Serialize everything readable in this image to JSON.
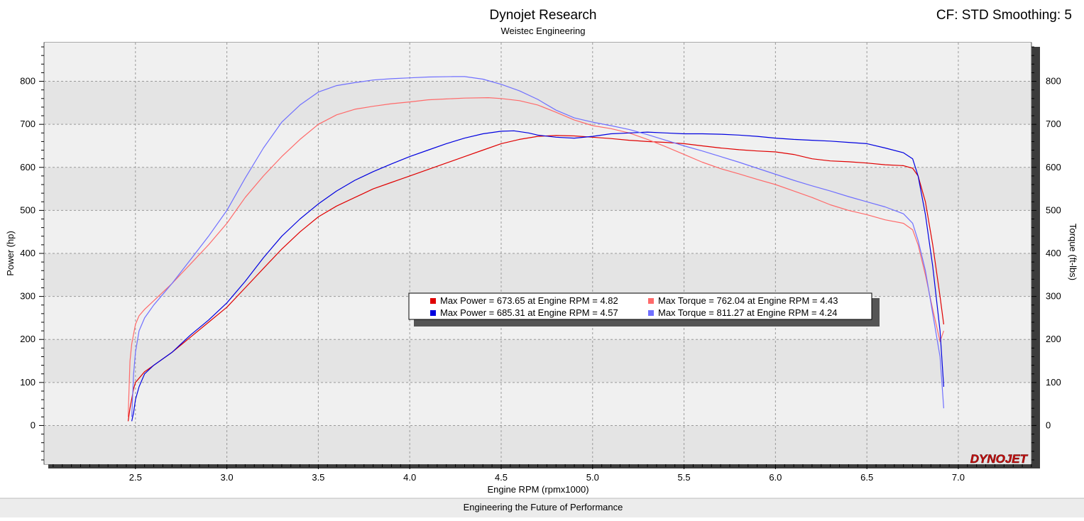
{
  "header": {
    "title": "Dynojet Research",
    "subtitle": "Weistec Engineering",
    "settings": "CF: STD Smoothing: 5"
  },
  "footer": {
    "tagline": "Engineering the Future of Performance"
  },
  "logo": {
    "text": "DYNOJET"
  },
  "colors": {
    "run1_power": "#e00000",
    "run1_torque": "#ff6a6a",
    "run2_power": "#0000e0",
    "run2_torque": "#7070ff",
    "band_dark": "#e4e4e4",
    "band_light": "#f0f0f0"
  },
  "legend": [
    {
      "label": "Max Power = 673.65 at Engine RPM = 4.82",
      "color": "#e00000"
    },
    {
      "label": "Max Torque = 762.04 at Engine RPM = 4.43",
      "color": "#ff6a6a"
    },
    {
      "label": "Max Power = 685.31 at Engine RPM = 4.57",
      "color": "#0000e0"
    },
    {
      "label": "Max Torque = 811.27 at Engine RPM = 4.24",
      "color": "#7070ff"
    }
  ],
  "chart_data": {
    "type": "line",
    "xlabel": "Engine RPM (rpmx1000)",
    "ylabel_left": "Power (hp)",
    "ylabel_right": "Torque (ft-lbs)",
    "xlim": [
      2.0,
      7.4
    ],
    "ylim": [
      -90,
      890
    ],
    "xticks": [
      "2.5",
      "3.0",
      "3.5",
      "4.0",
      "4.5",
      "5.0",
      "5.5",
      "6.0",
      "6.5",
      "7.0"
    ],
    "yticks": [
      "0",
      "100",
      "200",
      "300",
      "400",
      "500",
      "600",
      "700",
      "800"
    ],
    "grid": true,
    "legend_position": "center",
    "series": [
      {
        "color": "#e00000",
        "x": [
          2.46,
          2.47,
          2.49,
          2.5,
          2.55,
          2.6,
          2.7,
          2.8,
          2.9,
          3.0,
          3.1,
          3.2,
          3.3,
          3.4,
          3.5,
          3.6,
          3.7,
          3.8,
          3.9,
          4.0,
          4.1,
          4.2,
          4.3,
          4.4,
          4.5,
          4.6,
          4.7,
          4.8,
          4.9,
          5.0,
          5.1,
          5.2,
          5.3,
          5.4,
          5.5,
          5.6,
          5.7,
          5.8,
          5.9,
          6.0,
          6.1,
          6.2,
          6.3,
          6.4,
          6.5,
          6.6,
          6.7,
          6.75,
          6.78,
          6.82,
          6.86,
          6.9,
          6.92
        ],
        "values": [
          10,
          40,
          85,
          100,
          125,
          140,
          170,
          205,
          240,
          275,
          320,
          365,
          410,
          450,
          485,
          510,
          530,
          550,
          565,
          580,
          595,
          610,
          625,
          640,
          655,
          665,
          672,
          674,
          673,
          670,
          667,
          663,
          660,
          658,
          655,
          650,
          645,
          641,
          638,
          636,
          630,
          620,
          615,
          613,
          610,
          606,
          604,
          598,
          580,
          520,
          420,
          300,
          235
        ]
      },
      {
        "color": "#ff6a6a",
        "x": [
          2.46,
          2.47,
          2.48,
          2.5,
          2.52,
          2.55,
          2.6,
          2.7,
          2.8,
          2.9,
          3.0,
          3.1,
          3.2,
          3.3,
          3.4,
          3.5,
          3.6,
          3.7,
          3.8,
          3.9,
          4.0,
          4.1,
          4.2,
          4.3,
          4.43,
          4.5,
          4.6,
          4.7,
          4.8,
          4.9,
          5.0,
          5.1,
          5.2,
          5.3,
          5.4,
          5.5,
          5.6,
          5.7,
          5.8,
          5.9,
          6.0,
          6.1,
          6.2,
          6.3,
          6.4,
          6.5,
          6.6,
          6.7,
          6.75,
          6.78,
          6.82,
          6.86,
          6.9,
          6.92
        ],
        "values": [
          20,
          150,
          190,
          235,
          255,
          270,
          290,
          330,
          375,
          420,
          470,
          530,
          580,
          625,
          665,
          700,
          722,
          735,
          742,
          748,
          752,
          757,
          759,
          761,
          762,
          760,
          755,
          745,
          728,
          710,
          697,
          690,
          680,
          665,
          648,
          630,
          612,
          597,
          585,
          572,
          560,
          545,
          530,
          513,
          500,
          490,
          478,
          470,
          455,
          420,
          350,
          270,
          195,
          220
        ]
      },
      {
        "color": "#0000e0",
        "x": [
          2.48,
          2.49,
          2.5,
          2.52,
          2.55,
          2.6,
          2.7,
          2.8,
          2.9,
          3.0,
          3.1,
          3.2,
          3.3,
          3.4,
          3.5,
          3.6,
          3.7,
          3.8,
          3.9,
          4.0,
          4.1,
          4.2,
          4.3,
          4.4,
          4.5,
          4.57,
          4.65,
          4.7,
          4.8,
          4.9,
          5.0,
          5.1,
          5.2,
          5.3,
          5.4,
          5.5,
          5.6,
          5.7,
          5.8,
          5.9,
          6.0,
          6.1,
          6.2,
          6.3,
          6.4,
          6.5,
          6.6,
          6.7,
          6.75,
          6.78,
          6.82,
          6.86,
          6.9,
          6.92
        ],
        "values": [
          10,
          30,
          60,
          90,
          120,
          140,
          170,
          210,
          245,
          285,
          335,
          390,
          440,
          480,
          515,
          545,
          570,
          590,
          608,
          625,
          640,
          655,
          668,
          678,
          684,
          685,
          680,
          675,
          670,
          668,
          672,
          678,
          680,
          682,
          680,
          678,
          678,
          677,
          675,
          672,
          668,
          665,
          663,
          661,
          658,
          655,
          645,
          634,
          620,
          580,
          490,
          370,
          220,
          90
        ]
      },
      {
        "color": "#7070ff",
        "x": [
          2.48,
          2.49,
          2.5,
          2.52,
          2.55,
          2.6,
          2.7,
          2.8,
          2.9,
          3.0,
          3.1,
          3.2,
          3.3,
          3.4,
          3.5,
          3.6,
          3.7,
          3.8,
          3.9,
          4.0,
          4.1,
          4.24,
          4.3,
          4.4,
          4.5,
          4.6,
          4.7,
          4.8,
          4.9,
          5.0,
          5.1,
          5.2,
          5.3,
          5.4,
          5.5,
          5.6,
          5.7,
          5.8,
          5.9,
          6.0,
          6.1,
          6.2,
          6.3,
          6.4,
          6.5,
          6.6,
          6.7,
          6.75,
          6.78,
          6.82,
          6.86,
          6.9,
          6.92
        ],
        "values": [
          20,
          120,
          170,
          220,
          250,
          280,
          330,
          385,
          440,
          500,
          575,
          645,
          705,
          745,
          775,
          790,
          797,
          803,
          806,
          808,
          810,
          811,
          811,
          805,
          793,
          778,
          758,
          733,
          715,
          705,
          697,
          688,
          676,
          663,
          650,
          638,
          625,
          612,
          598,
          584,
          570,
          557,
          545,
          532,
          520,
          508,
          492,
          470,
          430,
          360,
          260,
          160,
          40
        ]
      }
    ]
  }
}
